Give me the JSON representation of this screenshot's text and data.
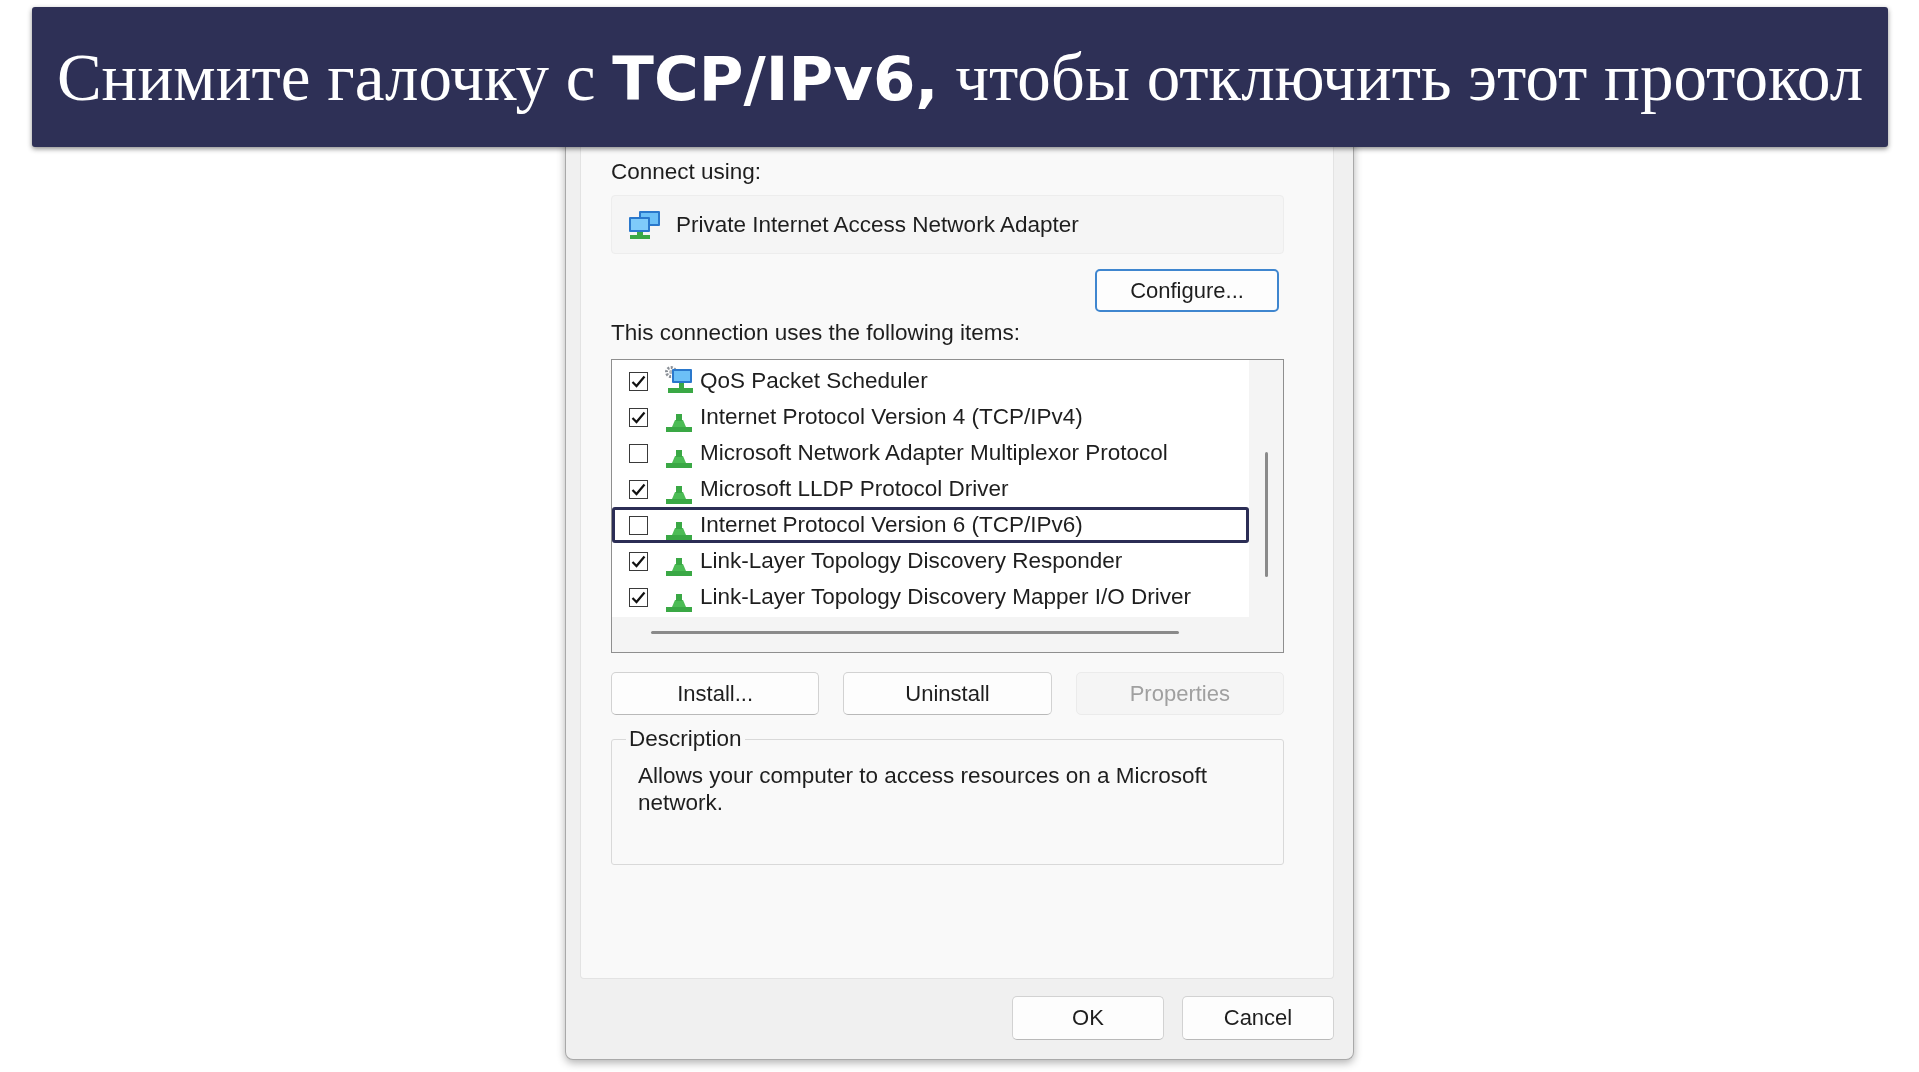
{
  "banner": {
    "text": "Снимите галочку с **TCP/IPv6,** чтобы отключить этот протокол"
  },
  "dialog": {
    "connect_label": "Connect using:",
    "adapter": {
      "name": "Private Internet Access Network Adapter"
    },
    "configure_button": {
      "label": "Configure...",
      "focused": true
    },
    "items_label": "This connection uses the following items:",
    "items": [
      {
        "label": "QoS Packet Scheduler",
        "kind": "service",
        "checked": true,
        "highlighted": false
      },
      {
        "label": "Internet Protocol Version 4 (TCP/IPv4)",
        "kind": "protocol",
        "checked": true,
        "highlighted": false
      },
      {
        "label": "Microsoft Network Adapter Multiplexor Protocol",
        "kind": "protocol",
        "checked": false,
        "highlighted": false
      },
      {
        "label": "Microsoft LLDP Protocol Driver",
        "kind": "protocol",
        "checked": true,
        "highlighted": false
      },
      {
        "label": "Internet Protocol Version 6 (TCP/IPv6)",
        "kind": "protocol",
        "checked": false,
        "highlighted": true
      },
      {
        "label": "Link-Layer Topology Discovery Responder",
        "kind": "protocol",
        "checked": true,
        "highlighted": false
      },
      {
        "label": "Link-Layer Topology Discovery Mapper I/O Driver",
        "kind": "protocol",
        "checked": true,
        "highlighted": false
      }
    ],
    "item_buttons": [
      {
        "label": "Install...",
        "disabled": false
      },
      {
        "label": "Uninstall",
        "disabled": false
      },
      {
        "label": "Properties",
        "disabled": true
      }
    ],
    "description": {
      "title": "Description",
      "text": "Allows your computer to access resources on a Microsoft network."
    },
    "footer_buttons": [
      {
        "label": "OK"
      },
      {
        "label": "Cancel"
      }
    ]
  }
}
